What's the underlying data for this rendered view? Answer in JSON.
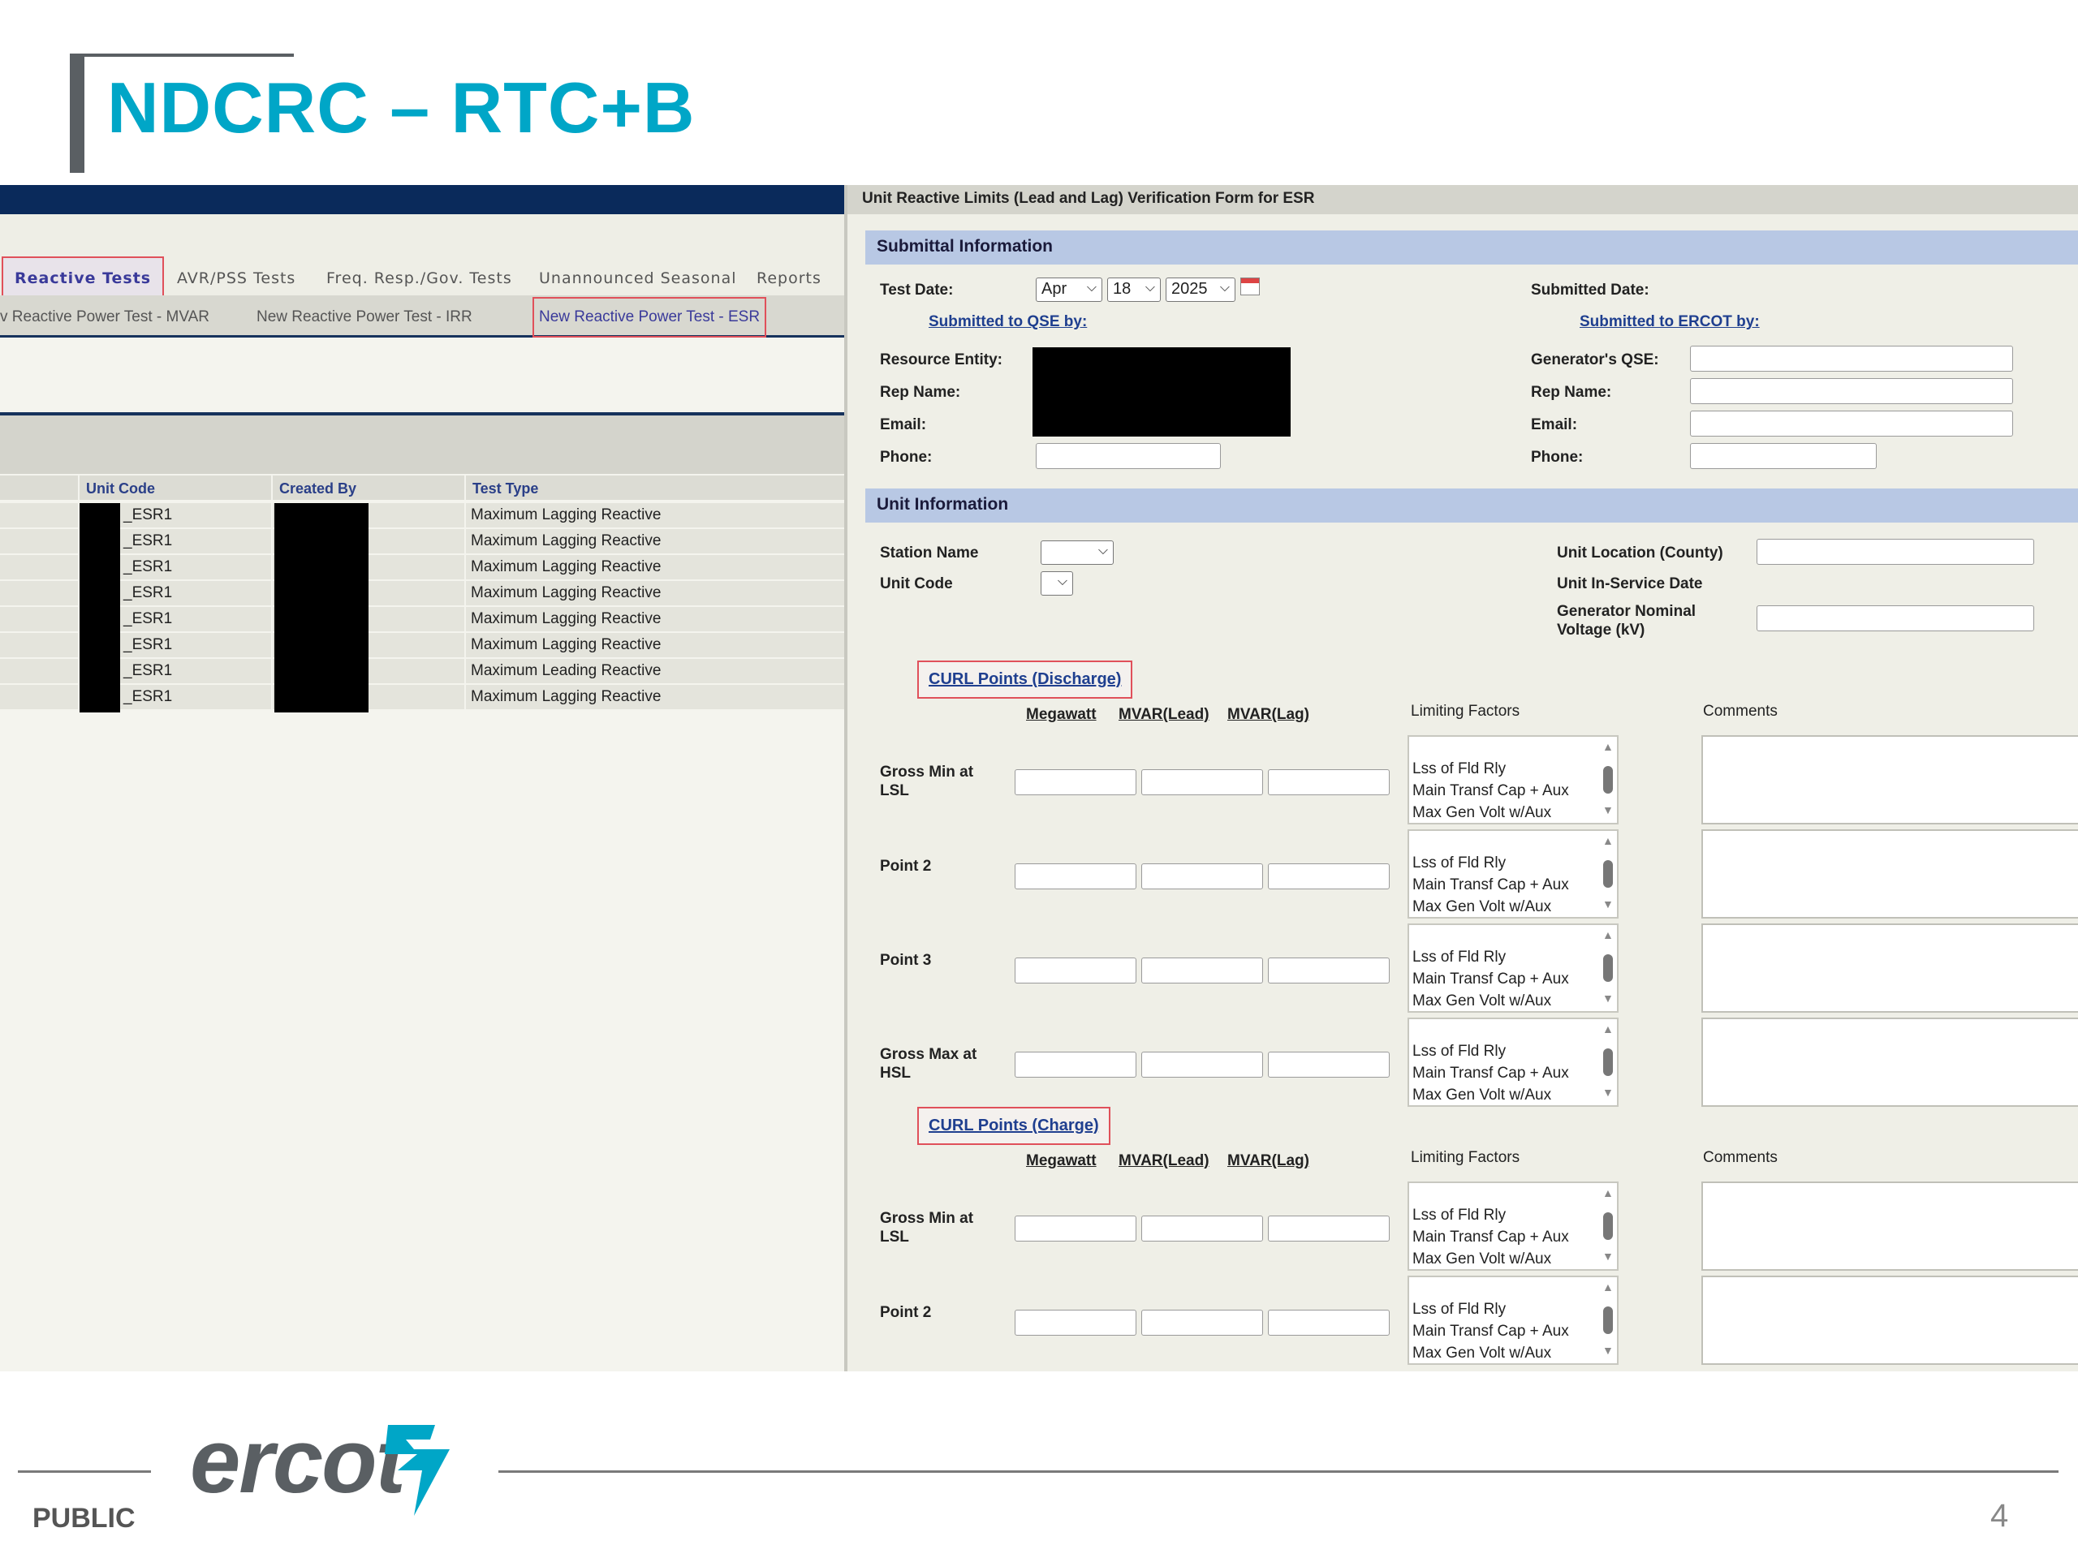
{
  "title": "NDCRC – RTC+B",
  "left": {
    "tabs": [
      "Reactive Tests",
      "AVR/PSS Tests",
      "Freq. Resp./Gov. Tests",
      "Unannounced Seasonal",
      "Reports"
    ],
    "subtabs": [
      "v Reactive Power Test - MVAR",
      "New Reactive Power Test - IRR",
      "New Reactive Power Test - ESR"
    ],
    "columns": [
      "Unit Code",
      "Created By",
      "Test Type"
    ],
    "rows": [
      {
        "unit": "_ESR1",
        "type": "Maximum Lagging Reactive"
      },
      {
        "unit": "_ESR1",
        "type": "Maximum Lagging Reactive"
      },
      {
        "unit": "_ESR1",
        "type": "Maximum Lagging Reactive"
      },
      {
        "unit": "_ESR1",
        "type": "Maximum Lagging Reactive"
      },
      {
        "unit": "_ESR1",
        "type": "Maximum Lagging Reactive"
      },
      {
        "unit": "_ESR1",
        "type": "Maximum Lagging Reactive"
      },
      {
        "unit": "_ESR1",
        "type": "Maximum Leading Reactive"
      },
      {
        "unit": "_ESR1",
        "type": "Maximum Lagging Reactive"
      }
    ]
  },
  "form": {
    "header": "Unit Reactive Limits (Lead and Lag) Verification Form for ESR",
    "submittal_section": "Submittal Information",
    "test_date_label": "Test Date:",
    "month": "Apr",
    "day": "18",
    "year": "2025",
    "submitted_date_label": "Submitted Date:",
    "submitted_qse_link": "Submitted to QSE by:",
    "submitted_ercot_link": "Submitted to ERCOT by:",
    "resource_entity_label": "Resource Entity:",
    "rep_name_label": "Rep Name:",
    "email_label": "Email:",
    "phone_label": "Phone:",
    "generators_qse_label": "Generator's QSE:",
    "unit_section": "Unit Information",
    "station_name_label": "Station Name",
    "unit_code_label": "Unit Code",
    "unit_location_label": "Unit Location (County)",
    "in_service_label": "Unit In-Service Date",
    "nominal_voltage_label": "Generator Nominal Voltage (kV)",
    "curl_discharge": "CURL Points (Discharge)",
    "curl_charge": "CURL Points (Charge)",
    "col_megawatt": "Megawatt",
    "col_mvar_lead": "MVAR(Lead)",
    "col_mvar_lag": "MVAR(Lag)",
    "limiting_factors": "Limiting Factors",
    "comments": "Comments",
    "factor_options": [
      "Lss of Fld Rly",
      "Main Transf Cap + Aux",
      "Max Gen Volt w/Aux"
    ],
    "discharge_points": [
      "Gross Min at LSL",
      "Point 2",
      "Point 3",
      "Gross Max at HSL"
    ],
    "charge_points": [
      "Gross Min at LSL",
      "Point 2"
    ]
  },
  "footer": {
    "classification": "PUBLIC",
    "logo": "ercot",
    "page": "4"
  }
}
